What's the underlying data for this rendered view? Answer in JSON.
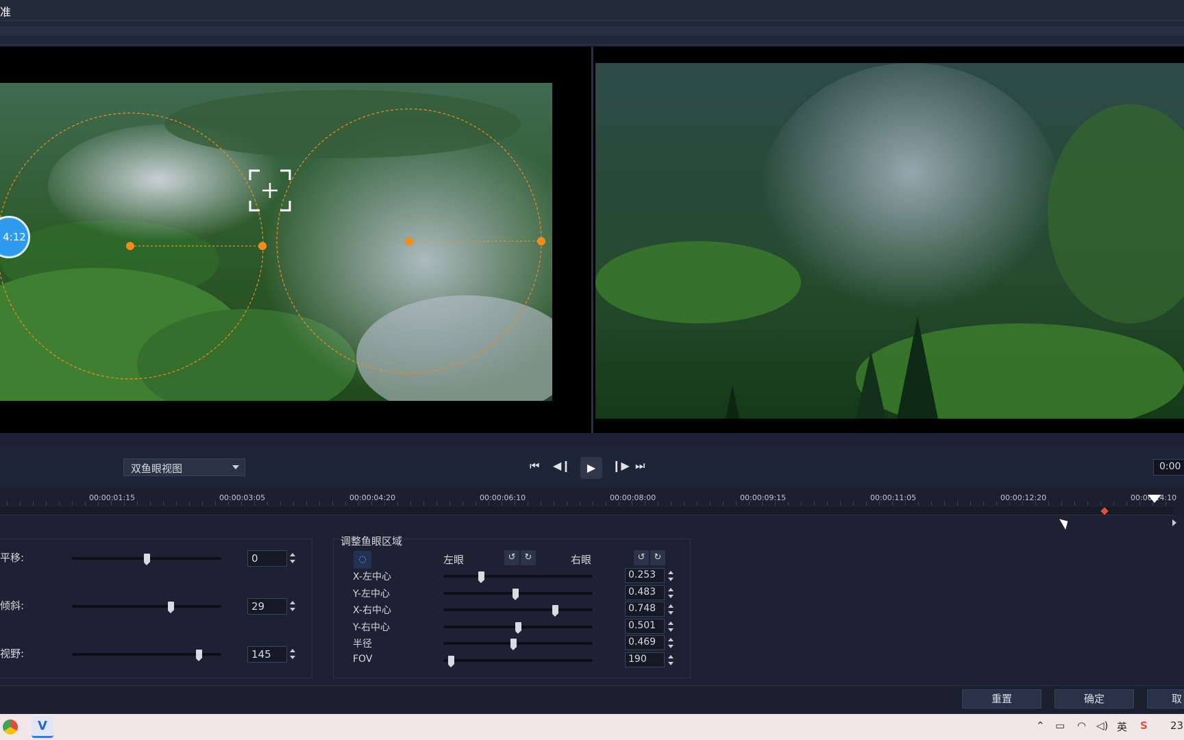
{
  "window": {
    "title": "准"
  },
  "preview": {
    "time_badge": "4:12"
  },
  "controls": {
    "view_mode": "双鱼眼视图",
    "timecode": "0:00",
    "icons": [
      "flip-icon",
      "swap-icon",
      "link-icon",
      "forward-icon",
      "redo-icon"
    ],
    "transport": [
      "go-start-icon",
      "step-back-icon",
      "play-icon",
      "step-forward-icon",
      "go-end-icon"
    ]
  },
  "timeline": {
    "labels": [
      "00:00:01:15",
      "00:00:03:05",
      "00:00:04:20",
      "00:00:06:10",
      "00:00:08:00",
      "00:00:09:15",
      "00:00:11:05",
      "00:00:12:20",
      "00:00:14:10"
    ]
  },
  "left_panel": {
    "rows": [
      {
        "label": "平移:",
        "value": "0",
        "fraction": 0.5
      },
      {
        "label": "倾斜:",
        "value": "29",
        "fraction": 0.66
      },
      {
        "label": "视野:",
        "value": "145",
        "fraction": 0.85
      }
    ]
  },
  "fisheye": {
    "title": "调整鱼眼区域",
    "left_eye": "左眼",
    "right_eye": "右眼",
    "rows": [
      {
        "label": "X-左中心",
        "value": "0.253",
        "fraction": 0.253
      },
      {
        "label": "Y-左中心",
        "value": "0.483",
        "fraction": 0.483
      },
      {
        "label": "X-右中心",
        "value": "0.748",
        "fraction": 0.748
      },
      {
        "label": "Y-右中心",
        "value": "0.501",
        "fraction": 0.501
      },
      {
        "label": "半径",
        "value": "0.469",
        "fraction": 0.469
      },
      {
        "label": "FOV",
        "value": "190",
        "fraction": 0.05
      }
    ]
  },
  "footer": {
    "reset": "重置",
    "ok": "确定",
    "cancel": "取"
  },
  "taskbar": {
    "ime": "英",
    "clock": "23"
  },
  "colors": {
    "accent_orange": "#f28c1a",
    "badge_blue": "#2f9bf0"
  }
}
